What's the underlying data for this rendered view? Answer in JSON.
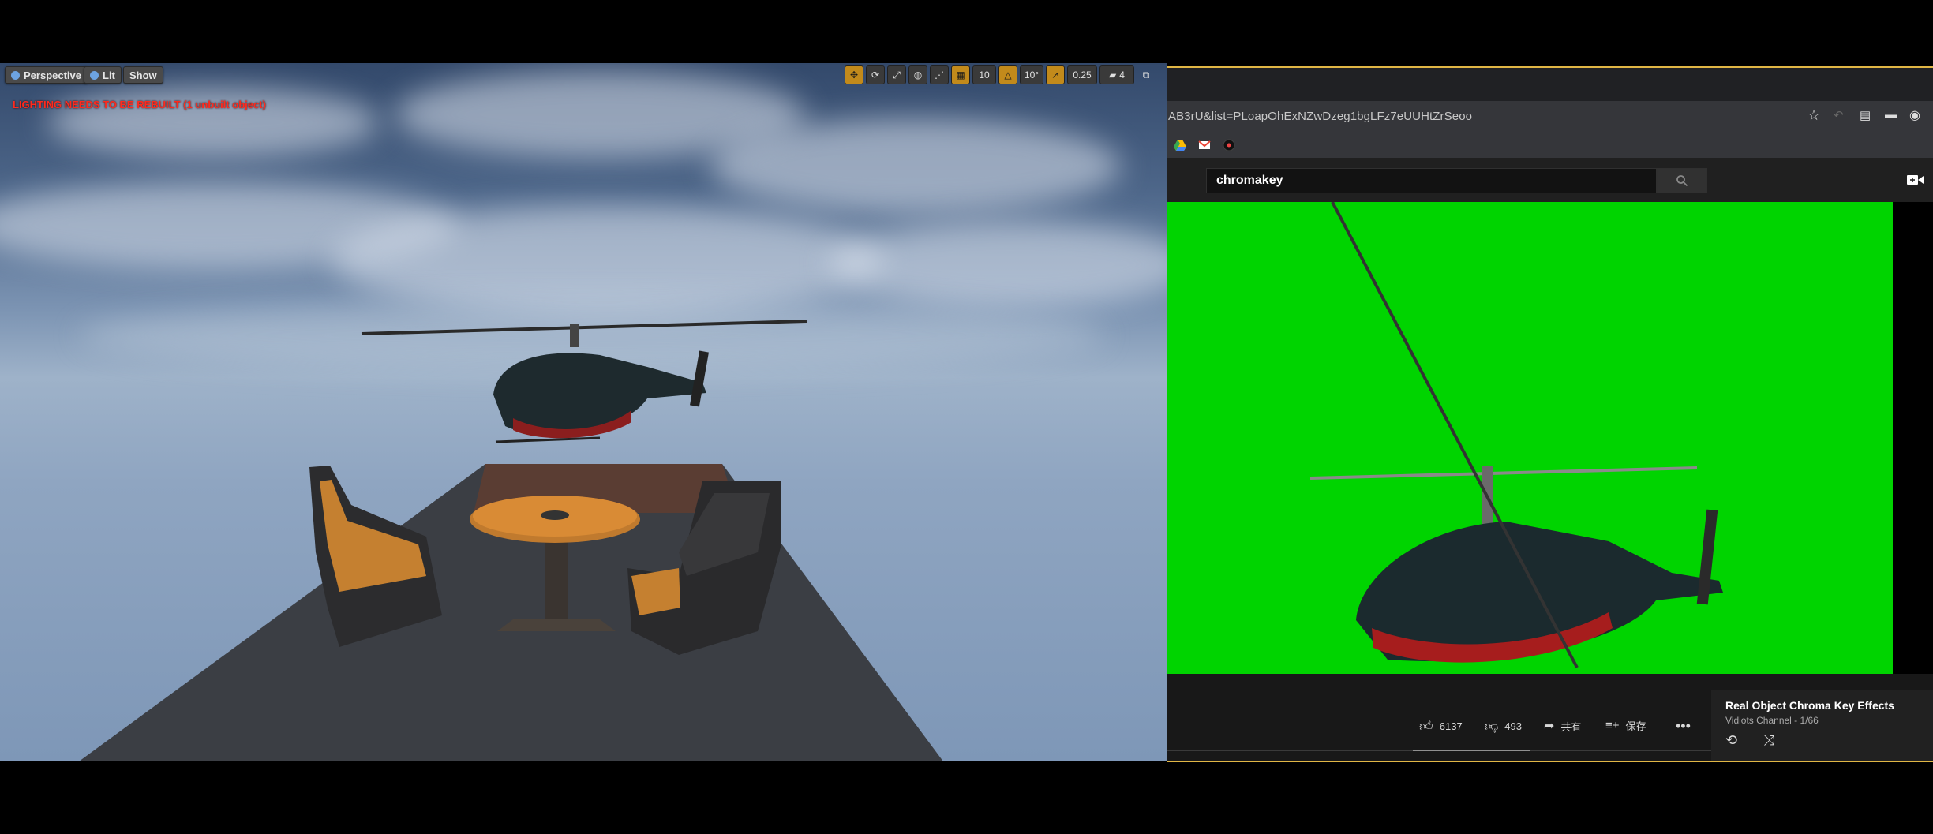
{
  "viewport": {
    "perspective_label": "Perspective",
    "lit_label": "Lit",
    "show_label": "Show",
    "lighting_warning": "LIGHTING NEEDS TO BE REBUILT (1 unbuilt object)",
    "grid_snap": "10",
    "rotation_snap": "10°",
    "scale_snap": "0.25",
    "camera_speed": "4"
  },
  "browser": {
    "url": "AB3rU&list=PLoapOhExNZwDzeg1bgLFz7eUUHtZrSeoo",
    "search_value": "chromakey",
    "likes": "6137",
    "dislikes": "493",
    "share_label": "共有",
    "save_label": "保存",
    "playlist_title": "Real Object Chroma Key Effects",
    "playlist_subtitle": "Vidiots Channel - 1/66"
  },
  "colors": {
    "chroma_green": "#00d400",
    "ue_accent": "#c28a1b",
    "browser_frame": "#e0b645"
  }
}
